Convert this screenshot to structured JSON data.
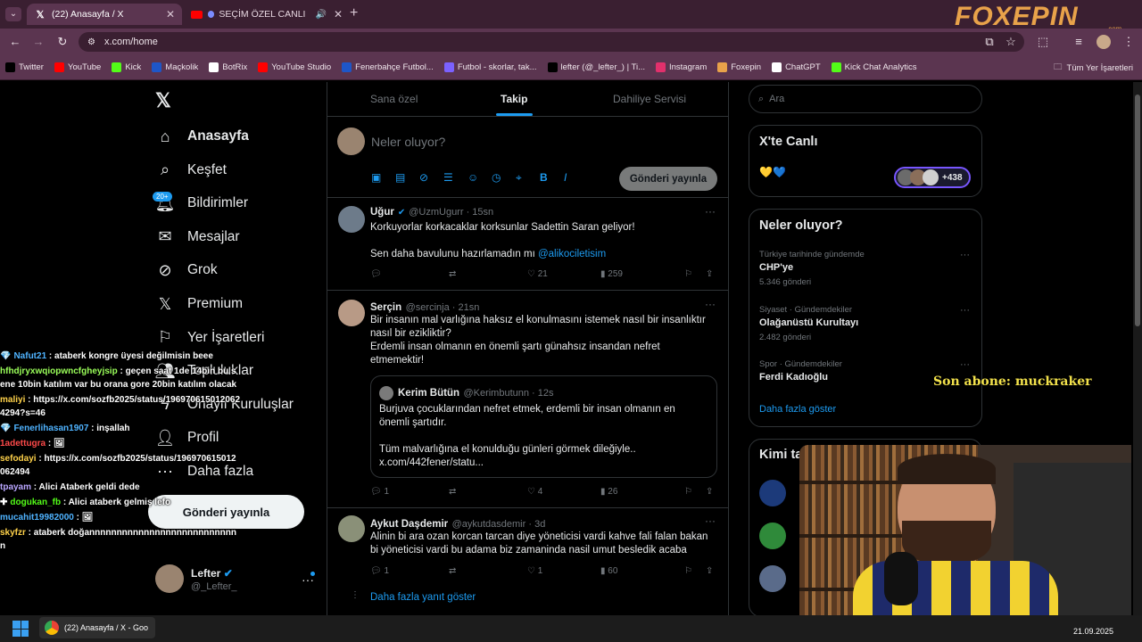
{
  "browser": {
    "tabs": [
      {
        "label": "(22) Anasayfa / X",
        "icon": "x-logo-icon",
        "active": true
      },
      {
        "label": "SEÇİM ÖZEL CANLI | Ku",
        "icon": "youtube-icon",
        "active": false
      }
    ],
    "url": "x.com/home",
    "bookmarks": [
      {
        "label": "Twitter",
        "icon": "x-logo-icon",
        "color": "#000000"
      },
      {
        "label": "YouTube",
        "icon": "youtube-icon",
        "color": "#ff0000"
      },
      {
        "label": "Kick",
        "icon": "kick-icon",
        "color": "#53fc18"
      },
      {
        "label": "Maçkolik",
        "icon": "mackolik-icon",
        "color": "#1e56c8"
      },
      {
        "label": "BotRix",
        "icon": "botrix-icon",
        "color": "#ffffff"
      },
      {
        "label": "YouTube Studio",
        "icon": "youtube-studio-icon",
        "color": "#ff0000"
      },
      {
        "label": "Fenerbahçe Futbol...",
        "icon": "m-icon",
        "color": "#1e56c8"
      },
      {
        "label": "Futbol - skorlar, tak...",
        "icon": "futbol-icon",
        "color": "#7b61ff"
      },
      {
        "label": "lefter (@_lefter_) | Ti...",
        "icon": "tiktok-icon",
        "color": "#000000"
      },
      {
        "label": "Instagram",
        "icon": "instagram-icon",
        "color": "#e1306c"
      },
      {
        "label": "Foxepin",
        "icon": "fox-icon",
        "color": "#e8a24a"
      },
      {
        "label": "ChatGPT",
        "icon": "chatgpt-icon",
        "color": "#ffffff"
      },
      {
        "label": "Kick Chat Analytics",
        "icon": "kick-analytics-icon",
        "color": "#53fc18"
      }
    ],
    "all_bookmarks": "Tüm Yer İşaretleri",
    "brand": "FOXEPIN",
    "brand_sub": ".com"
  },
  "sidebar": {
    "items": [
      {
        "label": "Anasayfa",
        "icon": "home-icon"
      },
      {
        "label": "Keşfet",
        "icon": "search-icon"
      },
      {
        "label": "Bildirimler",
        "icon": "bell-icon",
        "badge": "20+"
      },
      {
        "label": "Mesajlar",
        "icon": "envelope-icon"
      },
      {
        "label": "Grok",
        "icon": "grok-icon"
      },
      {
        "label": "Premium",
        "icon": "x-logo-icon"
      },
      {
        "label": "Yer İşaretleri",
        "icon": "bookmark-icon"
      },
      {
        "label": "Topluluklar",
        "icon": "people-icon"
      },
      {
        "label": "Onaylı Kuruluşlar",
        "icon": "lightning-icon"
      },
      {
        "label": "Profil",
        "icon": "person-icon"
      },
      {
        "label": "Daha fazla",
        "icon": "more-circle-icon"
      }
    ],
    "post_button": "Gönderi yayınla",
    "account": {
      "name": "Lefter",
      "handle": "@_Lefter_"
    }
  },
  "main": {
    "tabs": [
      "Sana özel",
      "Takip",
      "Dahiliye Servisi"
    ],
    "active_tab": "Takip",
    "composer_placeholder": "Neler oluyor?",
    "composer_button": "Gönderi yayınla",
    "tweets": [
      {
        "name": "Uğur",
        "handle": "@UzmUgurr",
        "time": "15sn",
        "verified": true,
        "text": "Korkuyorlar korkacaklar korksunlar Sadettin Saran geliyor!",
        "text2": "Sen daha bavulunu hazırlamadın mı ",
        "mention": "@alikociletisim",
        "replies": "",
        "retweets": "",
        "likes": "21",
        "views": "259"
      },
      {
        "name": "Serçin",
        "handle": "@sercinja",
        "time": "21sn",
        "verified": false,
        "text": "Bir insanın mal varlığına haksız el konulmasını istemek nasıl bir insanlıktır nasıl bir eziklikti̇r?",
        "text2": "Erdemli insan olmanın en önemli şartı günahsız insandan nefret etmemektir!",
        "quote": {
          "name": "Kerim Bütün",
          "handle": "@Kerimbutunn",
          "time": "12s",
          "text": "Burjuva çocuklarından nefret etmek, erdemli bir insan olmanın en önemli şartıdır.",
          "text2": "Tüm malvarlığına el konulduğu günleri görmek dileğiyle..",
          "link": "x.com/442fener/statu..."
        },
        "replies": "1",
        "retweets": "",
        "likes": "4",
        "views": "26"
      },
      {
        "name": "Aykut Daşdemir",
        "handle": "@aykutdasdemir",
        "time": "3d",
        "verified": false,
        "text": "Alinin bi ara ozan korcan tarcan diye yöneticisi vardi kahve fali falan bakan bi yöneticisi vardi bu adama biz zamaninda nasil umut besledik acaba",
        "replies": "1",
        "retweets": "",
        "likes": "1",
        "views": "60",
        "more_replies": "Daha fazla yanıt göster"
      }
    ]
  },
  "right": {
    "search_placeholder": "Ara",
    "live": {
      "title": "X'te Canlı",
      "emojis": "💛💙",
      "count": "+438"
    },
    "trends": {
      "title": "Neler oluyor?",
      "items": [
        {
          "context": "Türkiye tarihinde gündemde",
          "name": "CHP'ye",
          "count": "5.346 gönderi"
        },
        {
          "context": "Siyaset · Gündemdekiler",
          "name": "Olağanüstü Kurultayı",
          "count": "2.482 gönderi"
        },
        {
          "context": "Spor · Gündemdekiler",
          "name": "Ferdi Kadıoğlu",
          "count": ""
        }
      ],
      "show_more": "Daha fazla göster"
    },
    "who_to_follow": "Kimi takip etmeli"
  },
  "overlay": {
    "subscriber": "Son abone: muckraker",
    "chat": [
      {
        "user": "Nafut21",
        "color": "#4fb3ff",
        "badge": "💎",
        "msg": " : ataberk kongre üyesi değilmisin beee"
      },
      {
        "user": "hfhdjryxwqiopwncfgheyjsip",
        "color": "#9bff5a",
        "badge": "",
        "msg": " : geçen saat 1de 14bin bu sene 10bin katılım var bu orana gore 20bin katılım olacak"
      },
      {
        "user": "maliyi",
        "color": "#ffd24a",
        "badge": "",
        "msg": " : https://x.com/sozfb2025/status/1969706150120624294?s=46"
      },
      {
        "user": "Fenerlihasan1907",
        "color": "#4fb3ff",
        "badge": "💎",
        "msg": " : inşallah"
      },
      {
        "user": "1adettugra",
        "color": "#ff4a4a",
        "badge": "",
        "msg": " : 🖼"
      },
      {
        "user": "sefodayi",
        "color": "#ffd24a",
        "badge": "",
        "msg": " : https://x.com/sozfb2025/status/196970615012062494"
      },
      {
        "user": "tpayam",
        "color": "#b9a6ff",
        "badge": "",
        "msg": " : Alici Ataberk geldi dede"
      },
      {
        "user": "dogukan_fb",
        "color": "#53fc18",
        "badge": "✚",
        "msg": " : Alici ataberk gelmiş lefo"
      },
      {
        "user": "mucahit19982000",
        "color": "#4fb3ff",
        "badge": "",
        "msg": " : 🖼"
      },
      {
        "user": "skyfzr",
        "color": "#ffd24a",
        "badge": "",
        "msg": " : ataberk doğannnnnnnnnnnnnnnnnnnnnnnnnnnn"
      }
    ]
  },
  "taskbar": {
    "app_label": "(22) Anasayfa / X - Goo",
    "date": "21.09.2025"
  }
}
